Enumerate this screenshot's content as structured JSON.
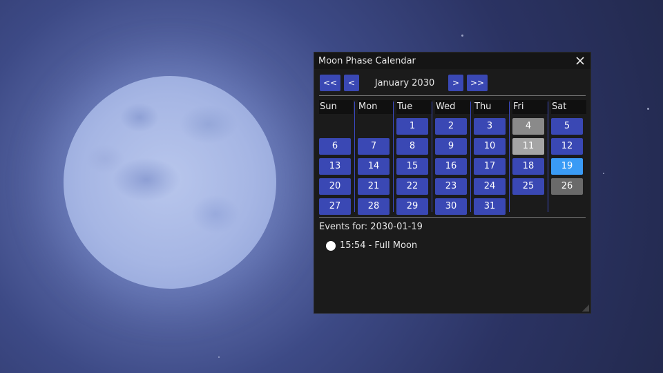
{
  "window": {
    "title": "Moon Phase Calendar"
  },
  "nav": {
    "prev_year": "<<",
    "prev_month": "<",
    "month_label": "January 2030",
    "next_month": ">",
    "next_year": ">>"
  },
  "weekdays": [
    "Sun",
    "Mon",
    "Tue",
    "Wed",
    "Thu",
    "Fri",
    "Sat"
  ],
  "days": [
    "1",
    "2",
    "3",
    "4",
    "5",
    "6",
    "7",
    "8",
    "9",
    "10",
    "11",
    "12",
    "13",
    "14",
    "15",
    "16",
    "17",
    "18",
    "19",
    "20",
    "21",
    "22",
    "23",
    "24",
    "25",
    "26",
    "27",
    "28",
    "29",
    "30",
    "31"
  ],
  "colors": {
    "day_button": "#3a48b4",
    "selected_day": "#3a9bf5",
    "moon_phase_day_gray": "#8a8a8a",
    "moon_phase_day_light": "#a5a5a5",
    "moon_phase_day_dark": "#6a6a6a"
  },
  "events": {
    "title": "Events for: 2030-01-19",
    "items": [
      {
        "icon": "full-moon-icon",
        "text": "15:54 - Full Moon"
      }
    ]
  }
}
